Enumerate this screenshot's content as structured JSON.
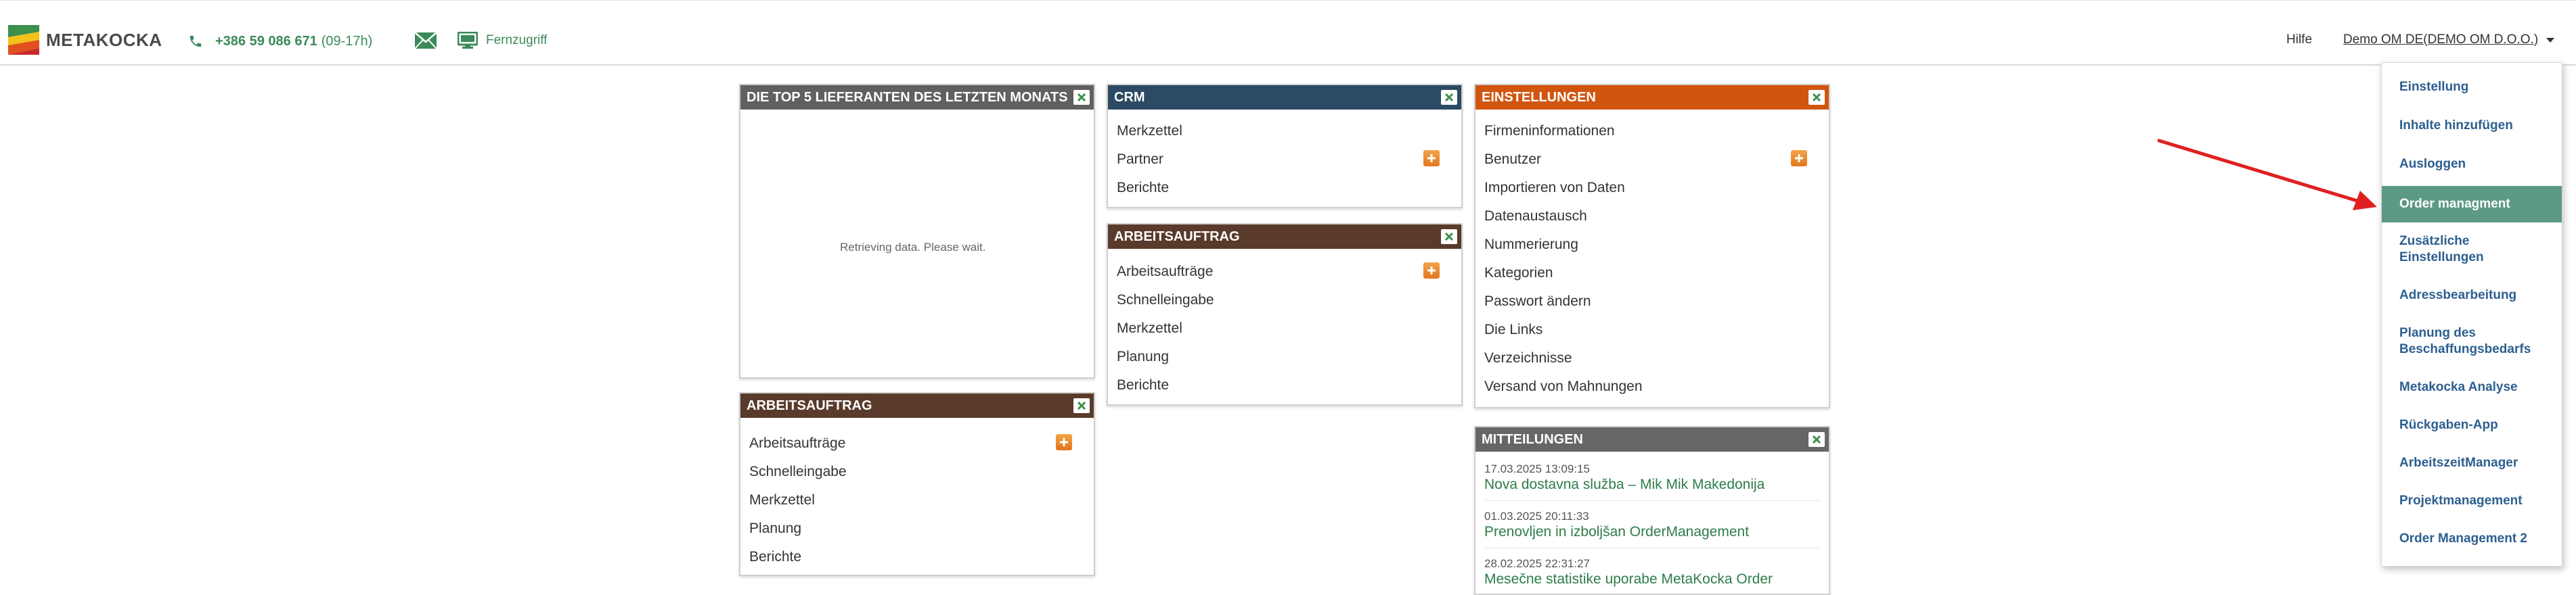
{
  "header": {
    "logo_text": "METAKOCKA",
    "phone_number": "+386 59 086 671",
    "phone_hours": "(09-17h)",
    "remote_label": "Fernzugriff",
    "help_label": "Hilfe",
    "user_label": "Demo OM DE(DEMO OM D.O.O.)"
  },
  "dropdown": {
    "items": [
      "Einstellung",
      "Inhalte hinzufügen",
      "Ausloggen",
      "Order managment",
      "Zusätzliche",
      "Einstellungen",
      "Adressbearbeitung",
      "Planung des",
      "Beschaffungsbedarfs",
      "Metakocka Analyse",
      "Rückgaben-App",
      "ArbeitszeitManager",
      "Projektmanagement",
      "Order Management 2"
    ],
    "active_item": "Order managment"
  },
  "panels": {
    "top5": {
      "title": "DIE TOP 5 LIEFERANTEN DES LETZTEN MONATS",
      "loading": "Retrieving data. Please wait."
    },
    "arbeit_left": {
      "title": "ARBEITSAUFTRAG",
      "rows": [
        "Arbeitsaufträge",
        "Schnelleingabe",
        "Merkzettel",
        "Planung",
        "Berichte"
      ]
    },
    "crm": {
      "title": "CRM",
      "rows": [
        "Merkzettel",
        "Partner",
        "Berichte"
      ]
    },
    "arbeit_mid": {
      "title": "ARBEITSAUFTRAG",
      "rows": [
        "Arbeitsaufträge",
        "Schnelleingabe",
        "Merkzettel",
        "Planung",
        "Berichte"
      ]
    },
    "einstellungen": {
      "title": "EINSTELLUNGEN",
      "rows": [
        "Firmeninformationen",
        "Benutzer",
        "Importieren von Daten",
        "Datenaustausch",
        "Nummerierung",
        "Kategorien",
        "Passwort ändern",
        "Die Links",
        "Verzeichnisse",
        "Versand von Mahnungen"
      ]
    },
    "mitteilungen": {
      "title": "MITTEILUNGEN",
      "news": [
        {
          "date": "17.03.2025 13:09:15",
          "title": "Nova dostavna služba – Mik Mik Makedonija"
        },
        {
          "date": "01.03.2025 20:11:33",
          "title": "Prenovljen in izboljšan OrderManagement"
        },
        {
          "date": "28.02.2025 22:31:27",
          "title": "Mesečne statistike uporabe MetaKocka Order"
        }
      ]
    }
  },
  "colors": {
    "crm_header": "#2c4a63",
    "arbeit_header": "#5a3a2a",
    "top5_header": "#606060",
    "einstellungen_header": "#d2550f",
    "mitteilungen_header": "#666666",
    "menu_active": "#5d9a84",
    "menu_text": "#2d5f8f",
    "link_green": "#2e7c47",
    "annotation_arrow": "#e02020"
  }
}
